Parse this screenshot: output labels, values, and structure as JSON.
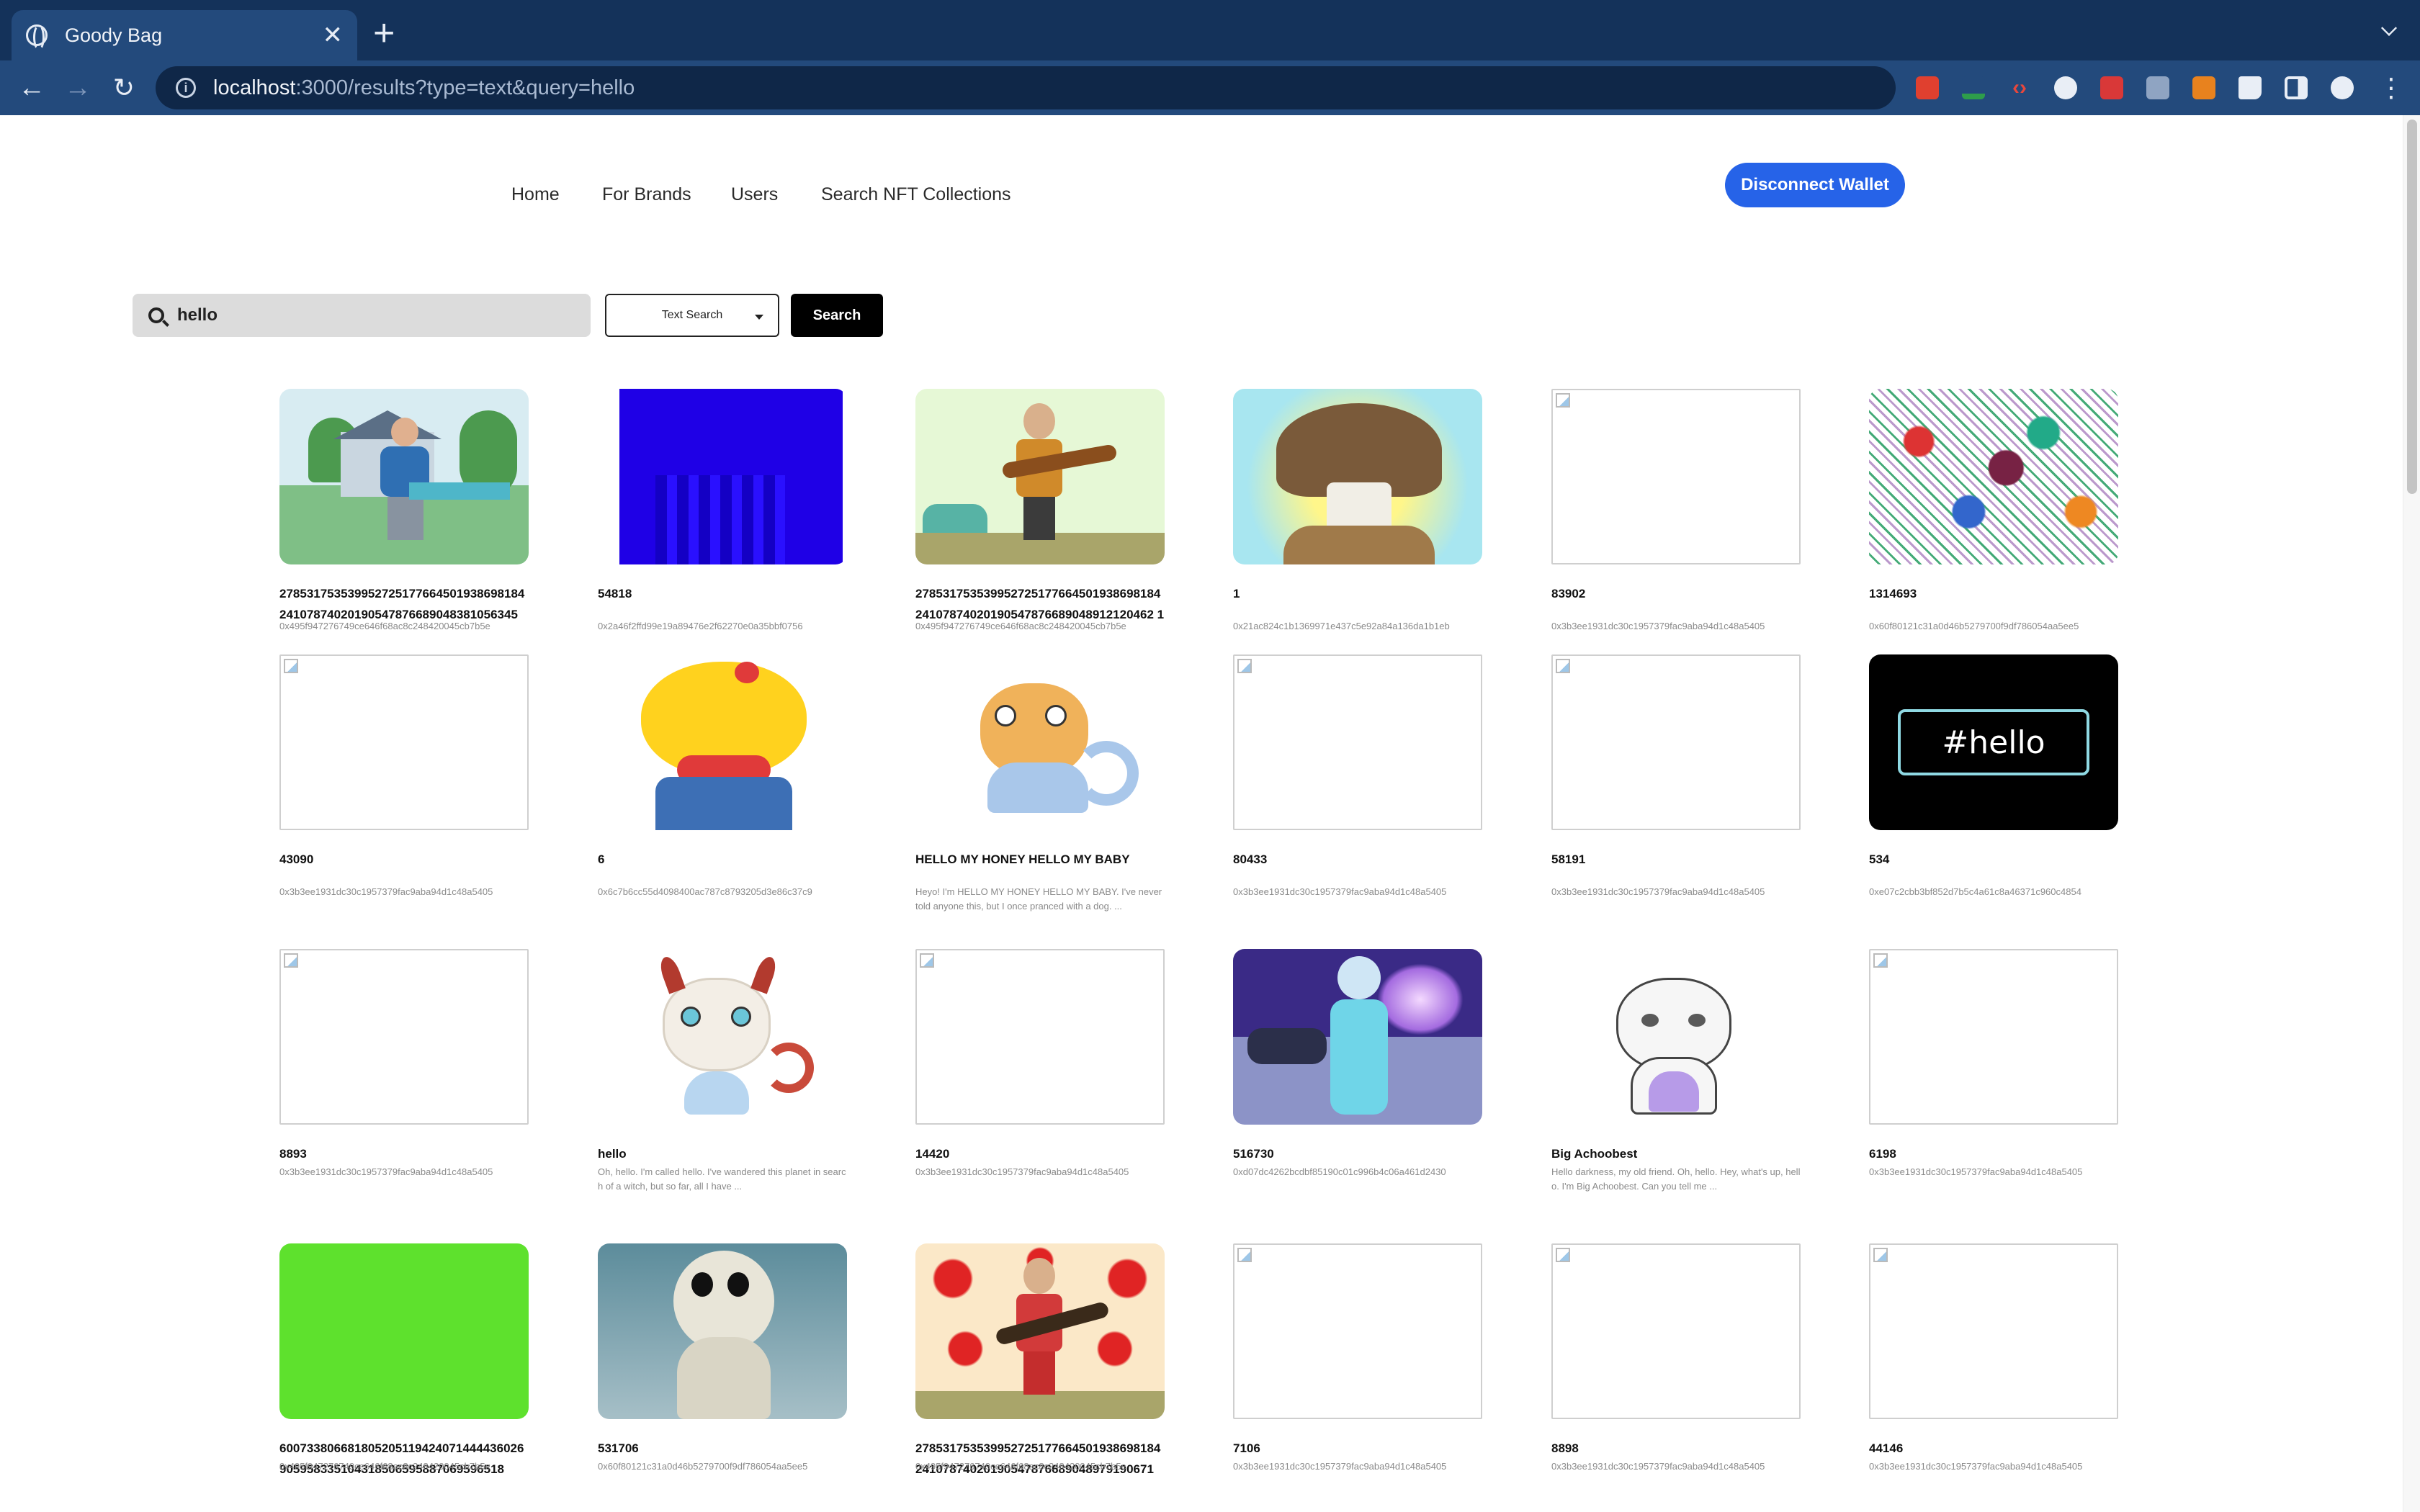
{
  "browser": {
    "tab_title": "Goody Bag",
    "url_host": "localhost",
    "url_rest": ":3000/results?type=text&query=hello"
  },
  "nav": {
    "home": "Home",
    "brands": "For Brands",
    "users": "Users",
    "search_collections": "Search NFT Collections",
    "disconnect": "Disconnect Wallet"
  },
  "search": {
    "query": "hello",
    "type": "Text Search",
    "button": "Search"
  },
  "results": [
    {
      "name": "27853175353995272517766450193869818424107874020190547876689048381056345",
      "sub": "0x495f947276749ce646f68ac8c248420045cb7b5e",
      "thumb": "house-man"
    },
    {
      "name": "54818",
      "sub": "0x2a46f2ffd99e19a89476e2f62270e0a35bbf0756",
      "thumb": "blue-bars"
    },
    {
      "name": "27853175353995272517766450193869818424107874020190547876689048912120462 1",
      "sub": "0x495f947276749ce646f68ac8c248420045cb7b5e",
      "thumb": "guitar-green"
    },
    {
      "name": "1",
      "sub": "0x21ac824c1b1369971e437c5e92a84a136da1b1eb",
      "thumb": "mushroom"
    },
    {
      "name": "83902",
      "sub": "0x3b3ee1931dc30c1957379fac9aba94d1c48a5405",
      "thumb": "broken"
    },
    {
      "name": "1314693",
      "sub": "0x60f80121c31a0d46b5279700f9df786054aa5ee5",
      "thumb": "noise"
    },
    {
      "name": "43090",
      "sub": "0x3b3ee1931dc30c1957379fac9aba94d1c48a5405",
      "thumb": "broken"
    },
    {
      "name": "6",
      "sub": "0x6c7b6cc55d4098400ac787c8793205d3e86c37c9",
      "thumb": "yellow-cat"
    },
    {
      "name": "HELLO MY HONEY HELLO MY BABY",
      "sub": "Heyo! I'm HELLO MY HONEY HELLO MY BABY. I've never told anyone this, but I once pranced with a dog. ...",
      "thumb": "kitty-blue"
    },
    {
      "name": "80433",
      "sub": "0x3b3ee1931dc30c1957379fac9aba94d1c48a5405",
      "thumb": "broken"
    },
    {
      "name": "58191",
      "sub": "0x3b3ee1931dc30c1957379fac9aba94d1c48a5405",
      "thumb": "broken"
    },
    {
      "name": "534",
      "sub": "0xe07c2cbb3bf852d7b5c4a61c8a46371c960c4854",
      "thumb": "hashtag",
      "label": "#hello"
    },
    {
      "name": "8893",
      "sub": "0x3b3ee1931dc30c1957379fac9aba94d1c48a5405",
      "thumb": "broken"
    },
    {
      "name": "hello",
      "sub": "Oh, hello. I'm called hello. I've wandered this planet in search of a witch, but so far, all I have ...",
      "thumb": "kitty-devil"
    },
    {
      "name": "14420",
      "sub": "0x3b3ee1931dc30c1957379fac9aba94d1c48a5405",
      "thumb": "broken"
    },
    {
      "name": "516730",
      "sub": "0xd07dc4262bcdbf85190c01c996b4c06a461d2430",
      "thumb": "astronaut"
    },
    {
      "name": "Big Achoobest",
      "sub": "Hello darkness, my old friend. Oh, hello. Hey, what's up, hello. I'm Big Achoobest. Can you tell me ...",
      "thumb": "kitty-white"
    },
    {
      "name": "6198",
      "sub": "0x3b3ee1931dc30c1957379fac9aba94d1c48a5405",
      "thumb": "broken"
    },
    {
      "name": "600733806681805205119424071444436026905958335104318506595887069596518",
      "sub": "0x495f947276749ce646f68ac8c248420045cb7b5e",
      "thumb": "green"
    },
    {
      "name": "531706",
      "sub": "0x60f80121c31a0d46b5279700f9df786054aa5ee5",
      "thumb": "globe-toy"
    },
    {
      "name": "27853175353995272517766450193869818424107874020190547876689048979190671",
      "sub": "0x495f947276749ce646f68ac8c248420045cb7b5e",
      "thumb": "guitar-hearts"
    },
    {
      "name": "7106",
      "sub": "0x3b3ee1931dc30c1957379fac9aba94d1c48a5405",
      "thumb": "broken"
    },
    {
      "name": "8898",
      "sub": "0x3b3ee1931dc30c1957379fac9aba94d1c48a5405",
      "thumb": "broken"
    },
    {
      "name": "44146",
      "sub": "0x3b3ee1931dc30c1957379fac9aba94d1c48a5405",
      "thumb": "broken"
    }
  ],
  "colors": {
    "accent": "#2663e8",
    "tabbar": "#14325a",
    "toolbar": "#234a7c"
  }
}
